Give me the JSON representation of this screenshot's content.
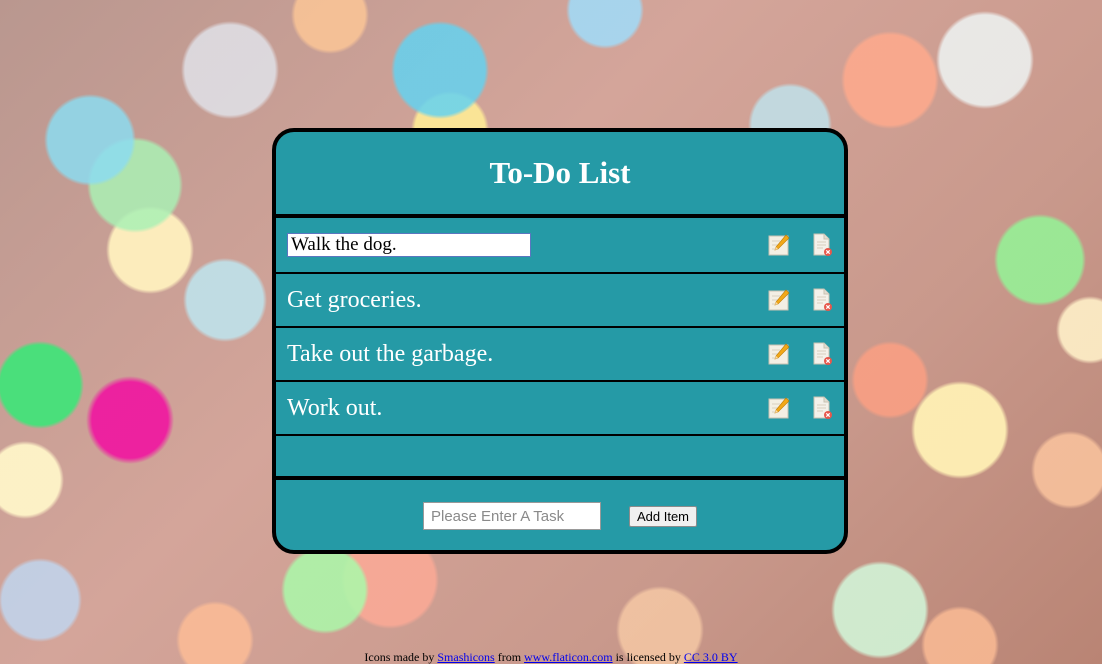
{
  "app": {
    "title": "To-Do List"
  },
  "tasks": [
    {
      "label": "Walk the dog.",
      "editing": true
    },
    {
      "label": "Get groceries.",
      "editing": false
    },
    {
      "label": "Take out the garbage.",
      "editing": false
    },
    {
      "label": "Work out.",
      "editing": false
    }
  ],
  "icons": {
    "edit": "pencil-on-paper-icon",
    "delete": "document-delete-icon"
  },
  "add_form": {
    "placeholder": "Please Enter A Task",
    "value": "",
    "button_label": "Add Item"
  },
  "footer": {
    "prefix": "Icons made by",
    "author": "Smashicons",
    "from": "from",
    "site": "www.flaticon.com",
    "licensed": "is licensed by",
    "license": "CC 3.0 BY"
  },
  "colors": {
    "card": "#259aa6",
    "border": "#000000",
    "text": "#ffffff"
  }
}
